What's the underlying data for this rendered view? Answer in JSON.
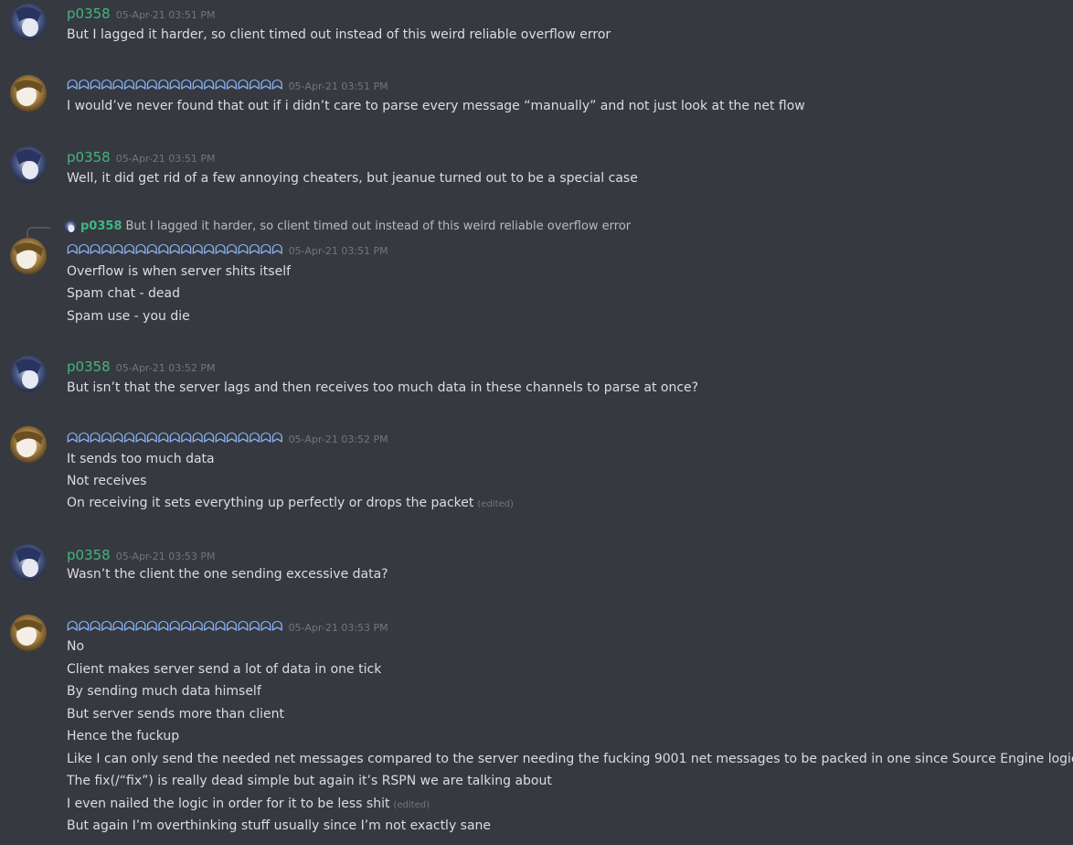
{
  "users": {
    "p0358": {
      "name": "p0358",
      "color": "#43b581"
    },
    "other": {
      "name": "ᗣᗣᗣᗣᗣᗣᗣᗣᗣᗣᗣᗣᗣᗣᗣᗣᗣᗣᗣ",
      "color": "#8ab4f8"
    }
  },
  "messages": [
    {
      "author": "p0358",
      "timestamp": "05-Apr-21 03:51 PM",
      "lines": [
        "But I lagged it harder, so client timed out instead of this weird reliable overflow error"
      ]
    },
    {
      "author": "ᗣᗣᗣᗣᗣᗣᗣᗣᗣᗣᗣᗣᗣᗣᗣᗣᗣᗣᗣ",
      "timestamp": "05-Apr-21 03:51 PM",
      "lines": [
        "I would’ve never found that out if i didn’t care to parse every message “manually” and not just look at the net flow"
      ]
    },
    {
      "author": "p0358",
      "timestamp": "05-Apr-21 03:51 PM",
      "lines": [
        "Well, it did get rid of a few annoying cheaters, but jeanue turned out to be a special case"
      ]
    },
    {
      "reply": {
        "author": "p0358",
        "text": "But I lagged it harder, so client timed out instead of this weird reliable overflow error"
      },
      "author": "ᗣᗣᗣᗣᗣᗣᗣᗣᗣᗣᗣᗣᗣᗣᗣᗣᗣᗣᗣ",
      "timestamp": "05-Apr-21 03:51 PM",
      "lines": [
        "Overflow is when server shits itself",
        "Spam chat - dead",
        "Spam use - you die"
      ]
    },
    {
      "author": "p0358",
      "timestamp": "05-Apr-21 03:52 PM",
      "lines": [
        "But isn’t that the server lags and then receives too much data in these channels to parse at once?"
      ]
    },
    {
      "author": "ᗣᗣᗣᗣᗣᗣᗣᗣᗣᗣᗣᗣᗣᗣᗣᗣᗣᗣᗣ",
      "timestamp": "05-Apr-21 03:52 PM",
      "lines": [
        "It sends too much data",
        "Not receives",
        "On receiving it sets everything up perfectly or drops the packet"
      ],
      "edited_label": "(edited)"
    },
    {
      "author": "p0358",
      "timestamp": "05-Apr-21 03:53 PM",
      "lines": [
        "Wasn’t the client the one sending excessive data?"
      ]
    },
    {
      "author": "ᗣᗣᗣᗣᗣᗣᗣᗣᗣᗣᗣᗣᗣᗣᗣᗣᗣᗣᗣ",
      "timestamp": "05-Apr-21 03:53 PM",
      "lines": [
        "No",
        "Client makes server send a lot of data in one tick",
        "By sending much data himself",
        "But server sends more than client",
        "Hence the fuckup",
        "Like I can only send the needed net messages compared to the server needing the fucking 9001 net messages to be packed in one since Source Engine logic loops",
        "The fix(/“fix”) is really dead simple but again it’s RSPN we are talking about",
        "I even nailed the logic in order for it to be less shit",
        "But again I’m overthinking stuff usually since I’m not exactly sane"
      ],
      "edited_label": "(edited)"
    }
  ]
}
